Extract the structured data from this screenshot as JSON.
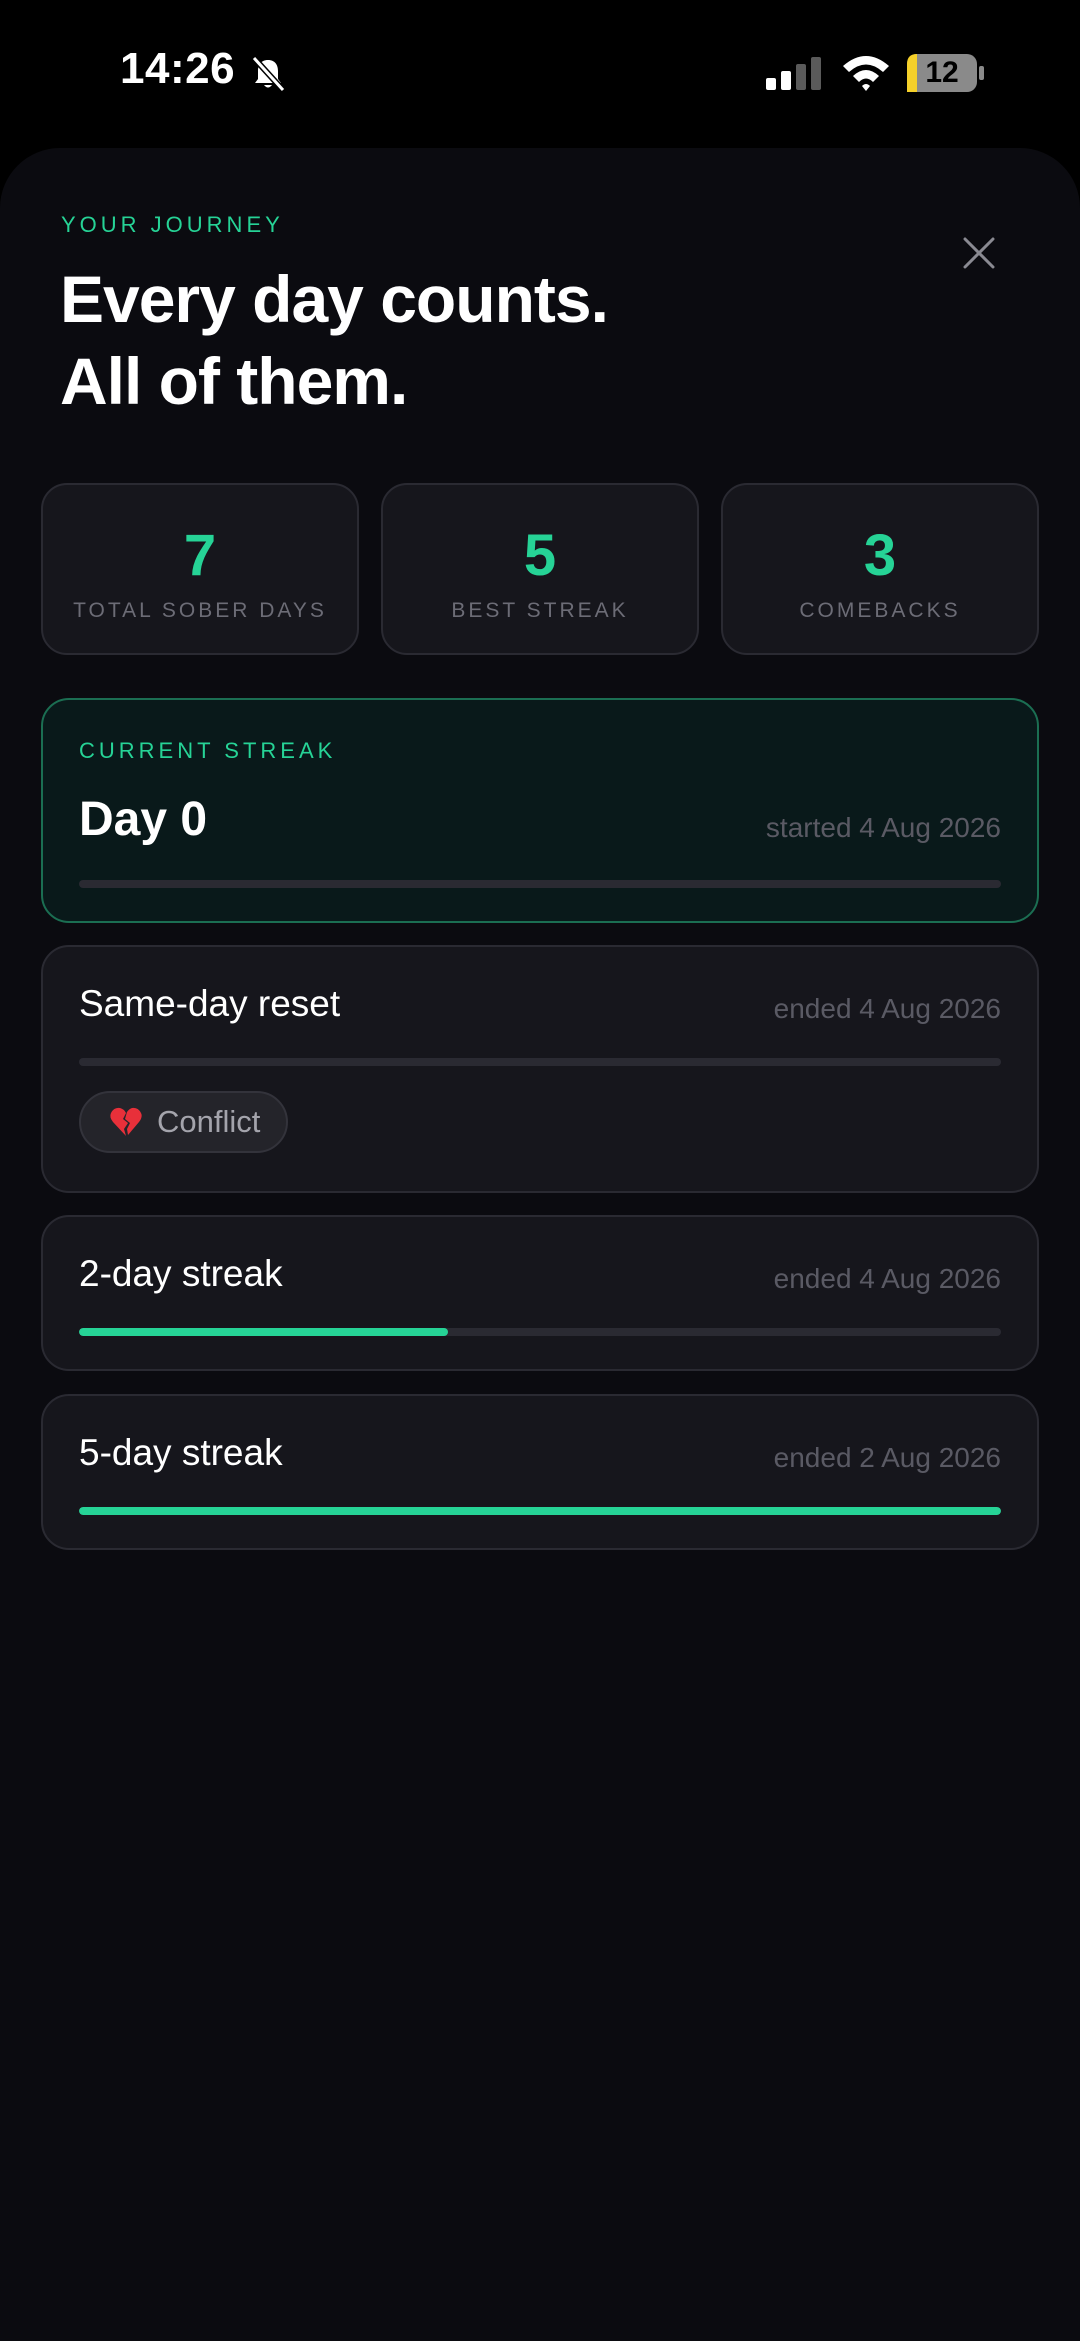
{
  "status_bar": {
    "time": "14:26",
    "battery": "12",
    "icons": [
      "bell-off-icon",
      "signal-icon",
      "wifi-icon",
      "battery-icon"
    ]
  },
  "header": {
    "eyebrow": "YOUR JOURNEY",
    "title_line1": "Every day counts.",
    "title_line2": "All of them.",
    "close_icon": "close-icon"
  },
  "stats": [
    {
      "value": "7",
      "label": "TOTAL SOBER DAYS"
    },
    {
      "value": "5",
      "label": "BEST STREAK"
    },
    {
      "value": "3",
      "label": "COMEBACKS"
    }
  ],
  "current_streak": {
    "eyebrow": "CURRENT STREAK",
    "title": "Day 0",
    "date": "started 4 Aug 2026",
    "progress": 0
  },
  "history": [
    {
      "title": "Same-day reset",
      "date": "ended 4 Aug 2026",
      "progress": 0,
      "tag": {
        "icon": "broken-heart-icon",
        "label": "Conflict"
      }
    },
    {
      "title": "2-day streak",
      "date": "ended 4 Aug 2026",
      "progress": 0.4
    },
    {
      "title": "5-day streak",
      "date": "ended 2 Aug 2026",
      "progress": 1.0
    }
  ],
  "colors": {
    "accent": "#26d396",
    "background": "#0b0b10",
    "card": "#16161c",
    "current_card": "#09191a"
  }
}
